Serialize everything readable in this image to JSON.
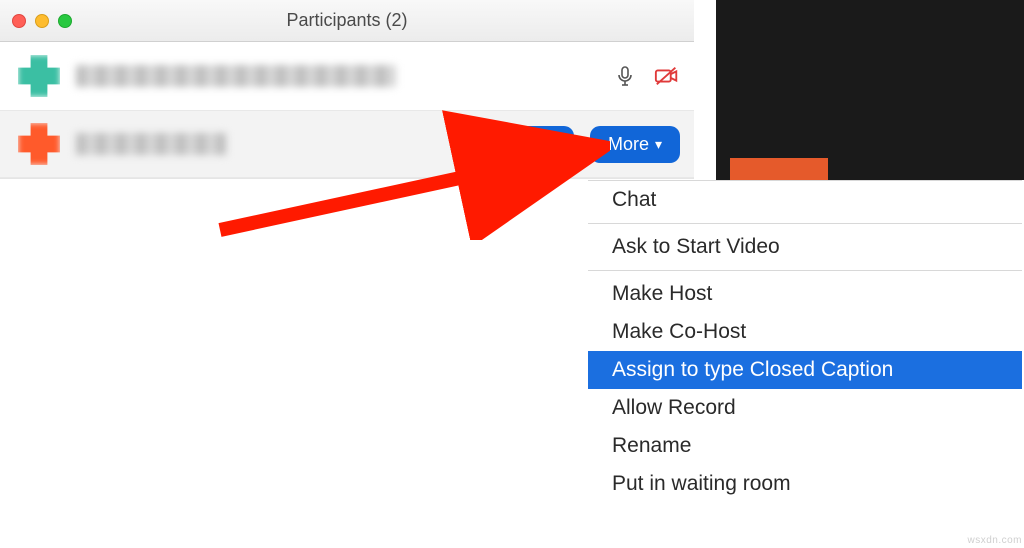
{
  "window": {
    "title": "Participants (2)"
  },
  "participants": {
    "host": {
      "icons": {
        "mic": "microphone-icon",
        "video_off": "video-off-icon"
      }
    },
    "guest": {
      "buttons": {
        "mute": "Mute",
        "more": "More"
      }
    }
  },
  "menu": {
    "chat": "Chat",
    "ask_start_video": "Ask to Start Video",
    "make_host": "Make Host",
    "make_cohost": "Make Co-Host",
    "assign_cc": "Assign to type Closed Caption",
    "allow_record": "Allow Record",
    "rename": "Rename",
    "waiting_room": "Put in waiting room"
  },
  "colors": {
    "accent": "#1166d8",
    "highlight": "#1b6fe0",
    "video_off": "#e03a3a"
  },
  "watermark": "wsxdn.com"
}
